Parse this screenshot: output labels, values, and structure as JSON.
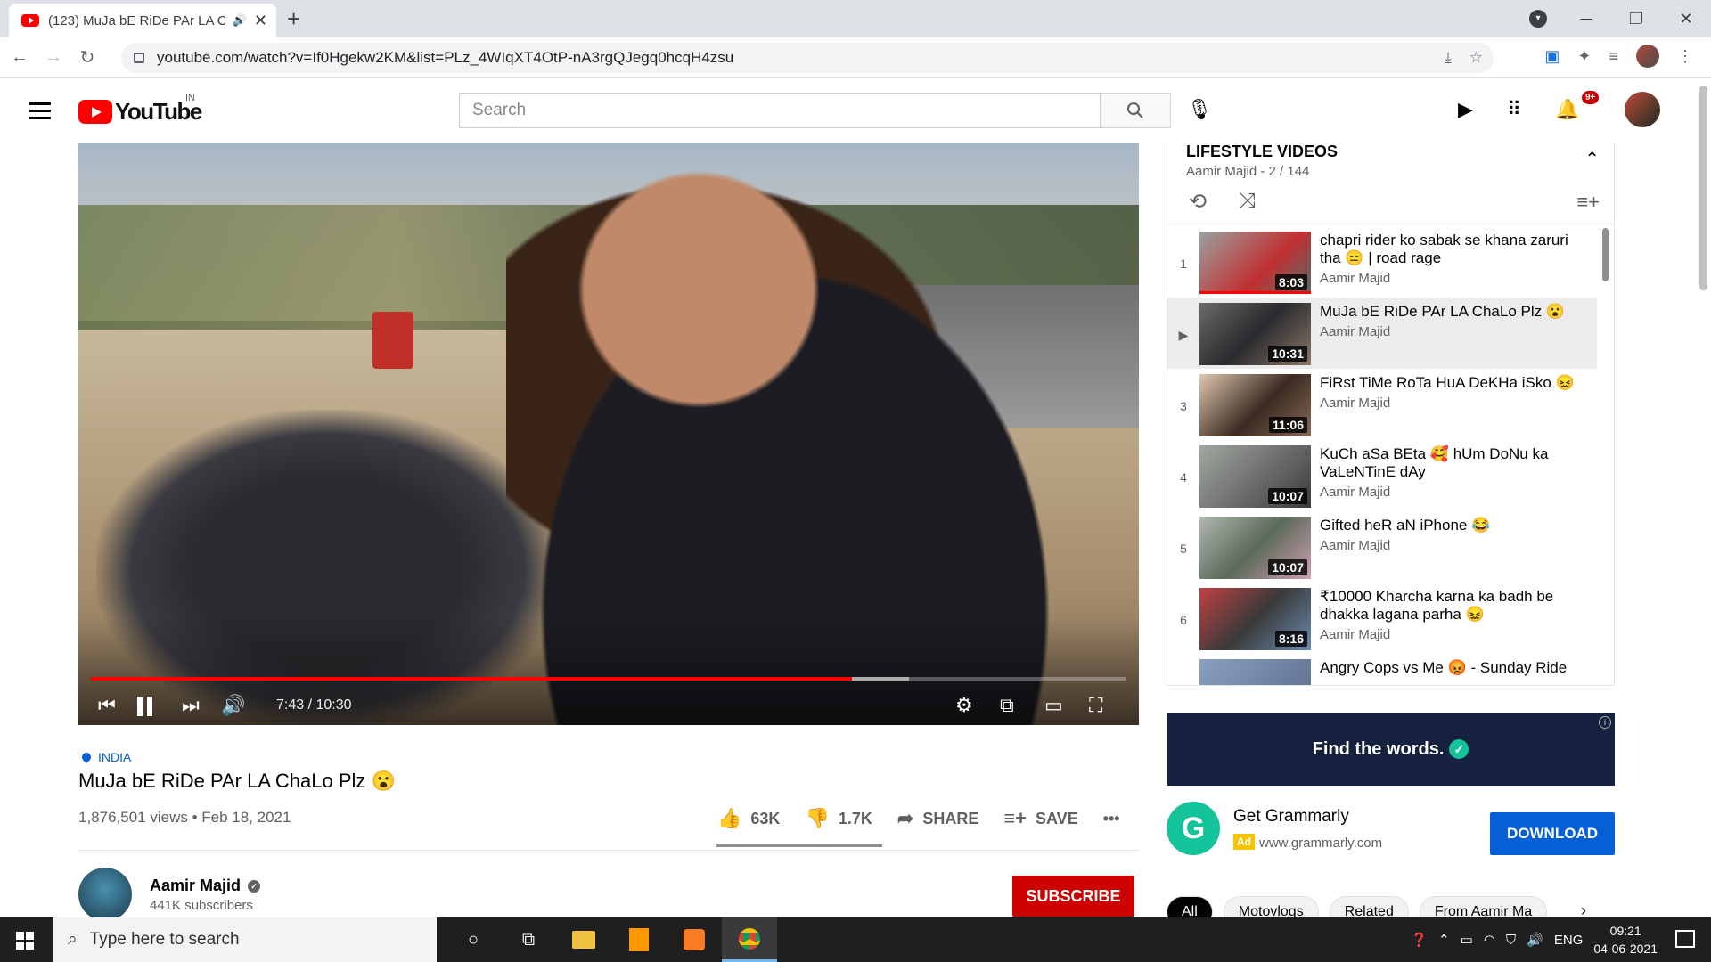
{
  "browser": {
    "tab_title": "(123) MuJa bE RiDe PAr LA C",
    "audio_icon": "speaker-icon",
    "new_tab": "+",
    "url": "youtube.com/watch?v=If0Hgekw2KM&list=PLz_4WIqXT4OtP-nA3rgQJegq0hcqH4zsu",
    "window_controls": [
      "─",
      "❐",
      "✕"
    ]
  },
  "masthead": {
    "logo_text": "YouTube",
    "country": "IN",
    "search_placeholder": "Search",
    "notification_count": "9+"
  },
  "player": {
    "time": "7:43 / 10:30",
    "played_fraction": 0.735,
    "loaded_fraction": 0.79
  },
  "video": {
    "location": "INDIA",
    "title": "MuJa bE RiDe PAr LA ChaLo Plz 😮",
    "views_date": "1,876,501 views • Feb 18, 2021",
    "likes": "63K",
    "dislikes": "1.7K",
    "share_label": "SHARE",
    "save_label": "SAVE",
    "more": "•••"
  },
  "channel": {
    "name": "Aamir Majid",
    "subscribers": "441K subscribers",
    "subscribe_label": "SUBSCRIBE"
  },
  "playlist": {
    "title": "LIFESTYLE VIDEOS",
    "subtitle": "Aamir Majid - 2 / 144",
    "items": [
      {
        "index": "1",
        "title": "chapri rider ko sabak se khana zaruri tha 😑 | road rage",
        "channel": "Aamir Majid",
        "duration": "8:03"
      },
      {
        "index": "▶",
        "title": "MuJa bE RiDe PAr LA ChaLo Plz 😮",
        "channel": "Aamir Majid",
        "duration": "10:31"
      },
      {
        "index": "3",
        "title": "FiRst TiMe RoTa HuA DeKHa iSko 😖",
        "channel": "Aamir Majid",
        "duration": "11:06"
      },
      {
        "index": "4",
        "title": "KuCh aSa BEta 🥰 hUm DoNu ka VaLeNTinE dAy",
        "channel": "Aamir Majid",
        "duration": "10:07"
      },
      {
        "index": "5",
        "title": "Gifted heR aN iPhone 😂",
        "channel": "Aamir Majid",
        "duration": "10:07"
      },
      {
        "index": "6",
        "title": "₹10000 Kharcha karna ka badh be dhakka lagana parha 😖",
        "channel": "Aamir Majid",
        "duration": "8:16"
      },
      {
        "index": "",
        "title": "Angry Cops vs Me 😡 - Sunday Ride",
        "channel": "",
        "duration": ""
      }
    ]
  },
  "ad": {
    "banner_text": "Find the words.",
    "info": "i",
    "logo_letter": "G",
    "name": "Get Grammarly",
    "badge": "Ad",
    "url": "www.grammarly.com",
    "cta": "DOWNLOAD"
  },
  "chips": [
    "All",
    "Motovlogs",
    "Related",
    "From Aamir Ma"
  ],
  "taskbar": {
    "search_placeholder": "Type here to search",
    "language": "ENG",
    "time": "09:21",
    "date": "04-06-2021"
  }
}
